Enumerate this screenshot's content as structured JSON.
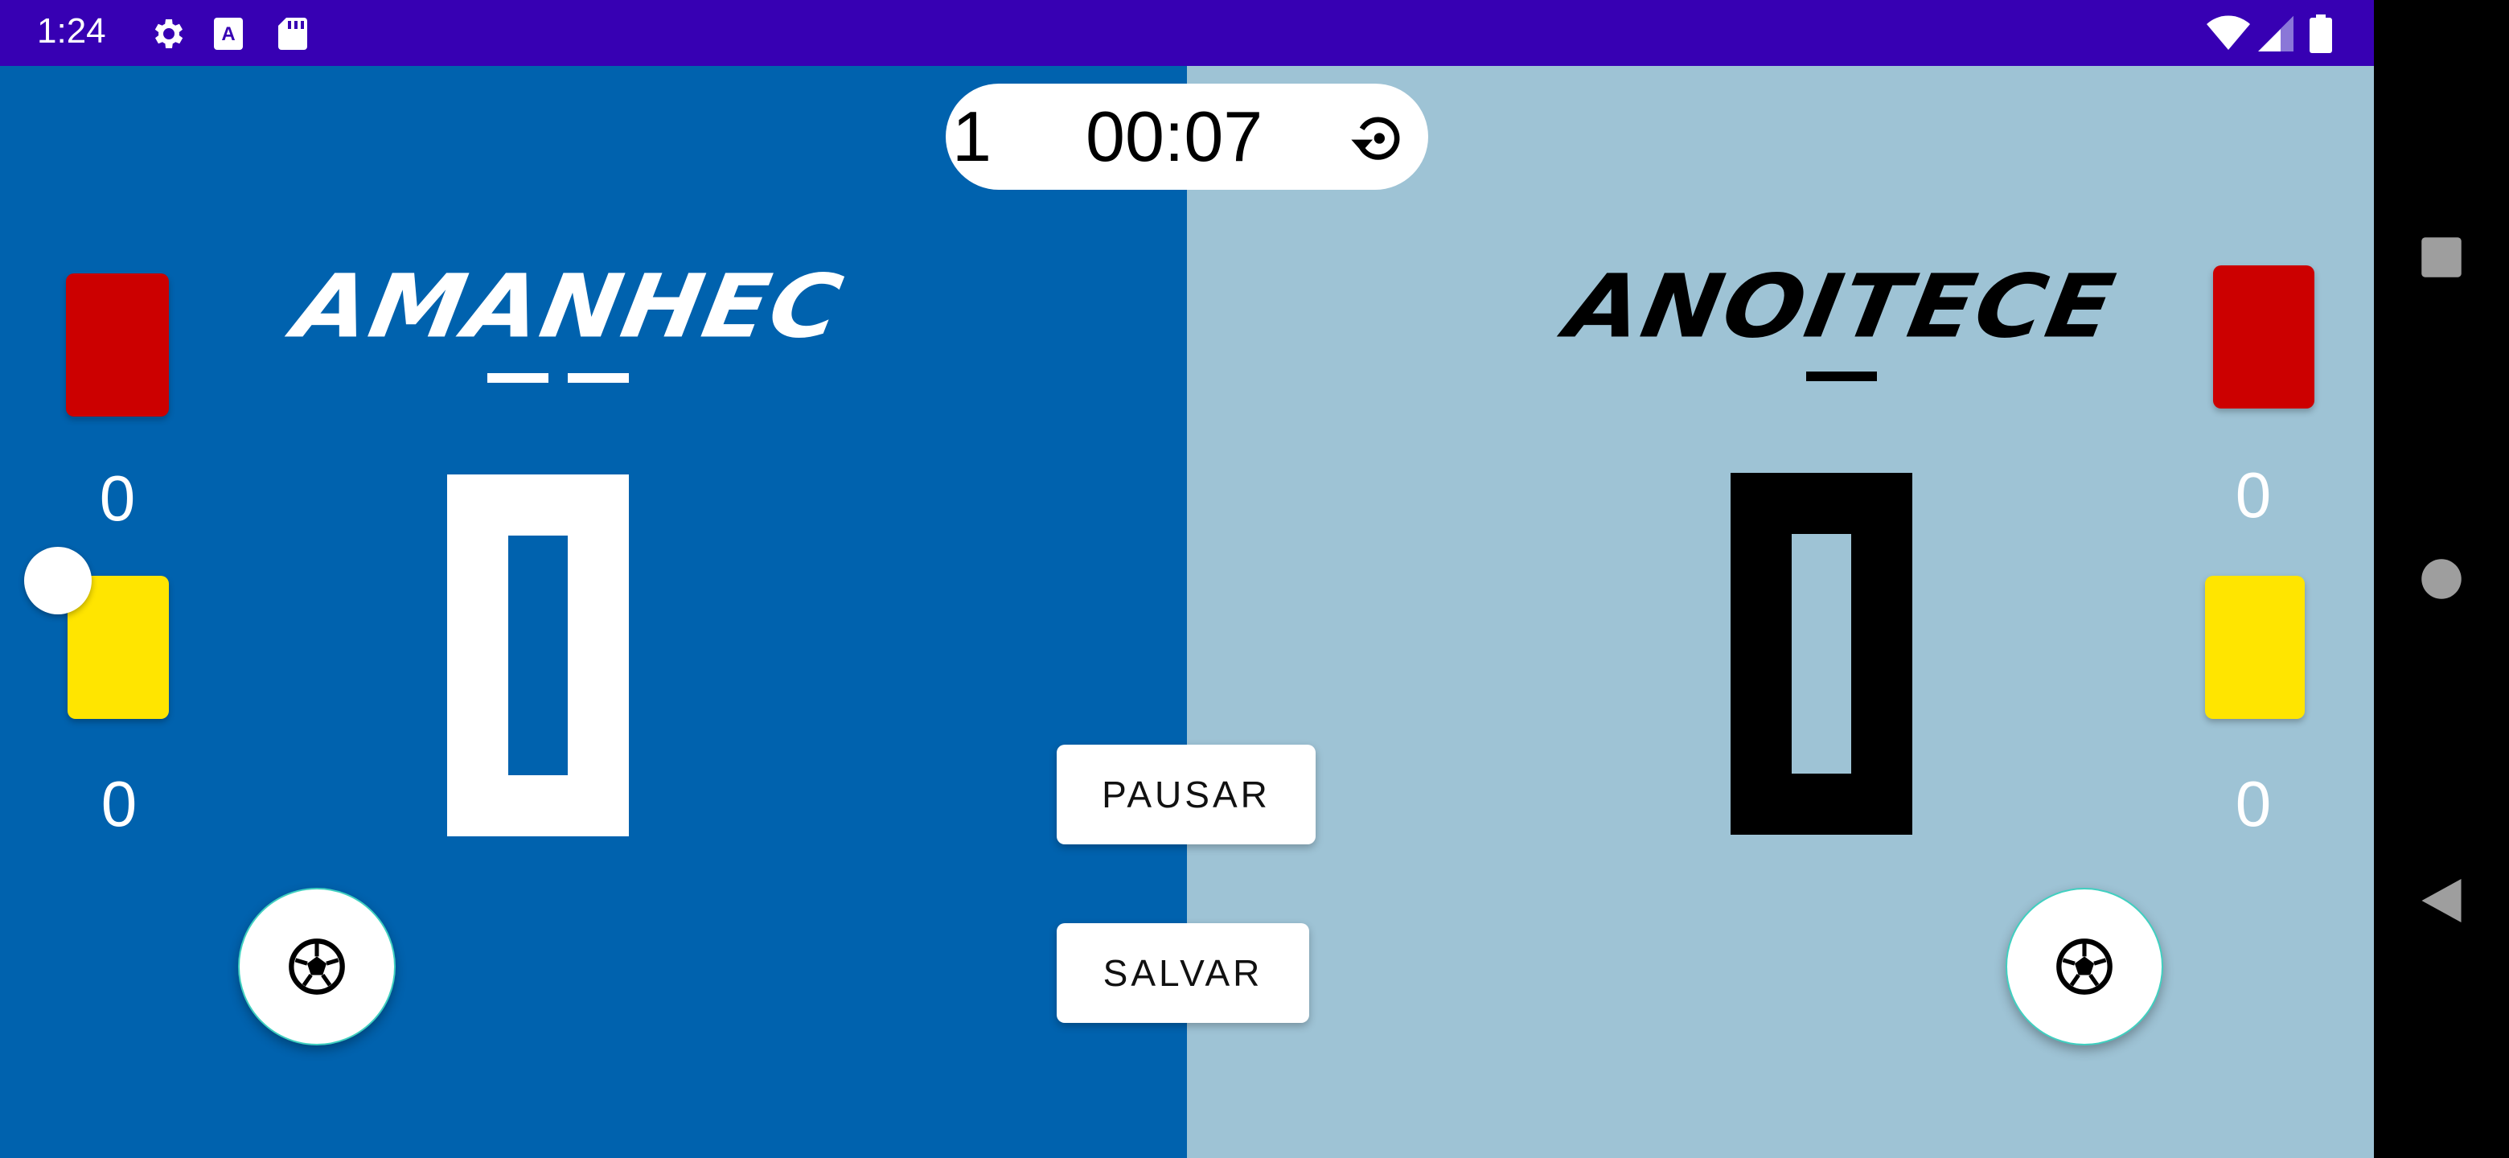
{
  "status_bar": {
    "time": "1:24",
    "left_icons": [
      "gear-icon",
      "keyboard-a-icon",
      "sd-card-icon"
    ],
    "right_icons": [
      "wifi-icon",
      "signal-icon",
      "battery-icon"
    ]
  },
  "timer": {
    "period": "1",
    "clock": "00:07",
    "reset_icon": "restart-icon"
  },
  "team_left": {
    "name": "AMANHEC",
    "score": "0",
    "red_cards": "0",
    "yellow_cards": "0",
    "color": "#0062ae",
    "text_color": "#ffffff"
  },
  "team_right": {
    "name": "ANOITECE",
    "score": "0",
    "red_cards": "0",
    "yellow_cards": "0",
    "color": "#9ec3d5",
    "text_color": "#000000"
  },
  "buttons": {
    "pause": "PAUSAR",
    "save": "SALVAR"
  },
  "colors": {
    "status_bar": "#3700b3",
    "red_card": "#cc0000",
    "yellow_card": "#ffe500"
  },
  "nav": [
    "recents-icon",
    "home-icon",
    "back-icon"
  ]
}
